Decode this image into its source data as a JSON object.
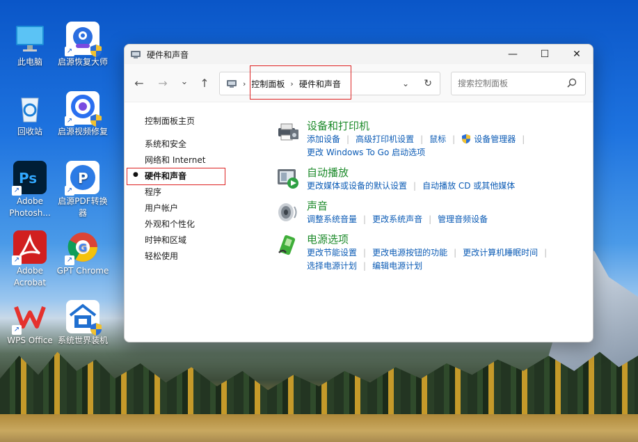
{
  "desktop": {
    "icons": [
      {
        "label": "此电脑"
      },
      {
        "label": "启源恢复大师"
      },
      {
        "label": "回收站"
      },
      {
        "label": "启源视频修复"
      },
      {
        "label": "Adobe Photosh..."
      },
      {
        "label": "启源PDF转换器"
      },
      {
        "label": "Adobe Acrobat"
      },
      {
        "label": "GPT Chrome"
      },
      {
        "label": "WPS Office"
      },
      {
        "label": "系统世界装机"
      }
    ]
  },
  "window": {
    "title": "硬件和声音",
    "controls": {
      "minimize": "—",
      "maximize": "☐",
      "close": "✕"
    }
  },
  "nav": {
    "back": "←",
    "forward": "→",
    "recent": "⌄",
    "up": "↑",
    "breadcrumb": [
      "控制面板",
      "硬件和声音"
    ],
    "sep": "›",
    "dropdown": "⌄",
    "refresh": "↻"
  },
  "search": {
    "placeholder": "搜索控制面板",
    "value": ""
  },
  "sidebar": {
    "home": "控制面板主页",
    "items": [
      "系统和安全",
      "网络和 Internet",
      "硬件和声音",
      "程序",
      "用户帐户",
      "外观和个性化",
      "时钟和区域",
      "轻松使用"
    ],
    "current_index": 2,
    "bullet": "●"
  },
  "categories": [
    {
      "title": "设备和打印机",
      "icon": "printer-icon",
      "link_rows": [
        [
          "添加设备",
          "高级打印机设置",
          "鼠标",
          "设备管理器"
        ],
        [
          "更改 Windows To Go 启动选项"
        ]
      ]
    },
    {
      "title": "自动播放",
      "icon": "autoplay-icon",
      "link_rows": [
        [
          "更改媒体或设备的默认设置",
          "自动播放 CD 或其他媒体"
        ]
      ]
    },
    {
      "title": "声音",
      "icon": "speaker-icon",
      "link_rows": [
        [
          "调整系统音量",
          "更改系统声音",
          "管理音频设备"
        ]
      ]
    },
    {
      "title": "电源选项",
      "icon": "power-icon",
      "link_rows": [
        [
          "更改节能设置",
          "更改电源按钮的功能",
          "更改计算机睡眠时间"
        ],
        [
          "选择电源计划",
          "编辑电源计划"
        ]
      ]
    }
  ],
  "colors": {
    "category_title": "#1c8a2a",
    "link": "#0b5bb5",
    "highlight_box": "#dd2222"
  }
}
